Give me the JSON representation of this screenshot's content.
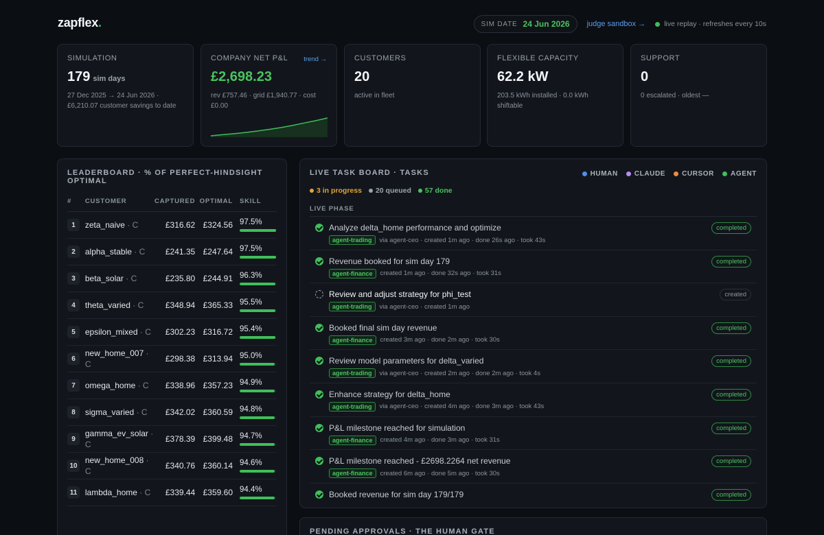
{
  "brand": {
    "name": "zapflex",
    "dot": "."
  },
  "topbar": {
    "sim_date_label": "SIM DATE",
    "sim_date": "24 Jun 2026",
    "judge_link": "judge sandbox →",
    "live_text": "live replay · refreshes every 10s"
  },
  "kpis": {
    "simulation": {
      "label": "SIMULATION",
      "value": "179",
      "unit": "sim days",
      "sub1": "27 Dec 2025 → 24 Jun 2026 ·",
      "sub2": "£6,210.07 customer savings to date"
    },
    "pnl": {
      "label": "COMPANY NET P&L",
      "value": "£2,698.23",
      "trend": "trend →",
      "sub1": "rev £757.46 · grid £1,940.77 · cost",
      "sub2": "£0.00",
      "spark": [
        0.0,
        0.06,
        0.12,
        0.19,
        0.27,
        0.36,
        0.46,
        0.58,
        0.72,
        0.85,
        1.0
      ]
    },
    "customers": {
      "label": "CUSTOMERS",
      "value": "20",
      "sub1": "active in fleet"
    },
    "capacity": {
      "label": "FLEXIBLE CAPACITY",
      "value": "62.2 kW",
      "sub1": "203.5 kWh installed · 0.0 kWh",
      "sub2": "shiftable"
    },
    "support": {
      "label": "SUPPORT",
      "value": "0",
      "sub1": "0 escalated · oldest —"
    }
  },
  "leaderboard": {
    "title": "LEADERBOARD · % OF PERFECT-HINDSIGHT OPTIMAL",
    "columns": [
      "#",
      "CUSTOMER",
      "CAPTURED",
      "OPTIMAL",
      "SKILL"
    ],
    "rows": [
      {
        "rank": "1",
        "name": "zeta_naive",
        "tier": "· C",
        "captured": "£316.62",
        "optimal": "£324.56",
        "skill": "97.5%",
        "pct": 97.5
      },
      {
        "rank": "2",
        "name": "alpha_stable",
        "tier": "· C",
        "captured": "£241.35",
        "optimal": "£247.64",
        "skill": "97.5%",
        "pct": 97.5
      },
      {
        "rank": "3",
        "name": "beta_solar",
        "tier": "· C",
        "captured": "£235.80",
        "optimal": "£244.91",
        "skill": "96.3%",
        "pct": 96.3
      },
      {
        "rank": "4",
        "name": "theta_varied",
        "tier": "· C",
        "captured": "£348.94",
        "optimal": "£365.33",
        "skill": "95.5%",
        "pct": 95.5
      },
      {
        "rank": "5",
        "name": "epsilon_mixed",
        "tier": "· C",
        "captured": "£302.23",
        "optimal": "£316.72",
        "skill": "95.4%",
        "pct": 95.4
      },
      {
        "rank": "6",
        "name": "new_home_007",
        "tier": "· C",
        "captured": "£298.38",
        "optimal": "£313.94",
        "skill": "95.0%",
        "pct": 95.0
      },
      {
        "rank": "7",
        "name": "omega_home",
        "tier": "· C",
        "captured": "£338.96",
        "optimal": "£357.23",
        "skill": "94.9%",
        "pct": 94.9
      },
      {
        "rank": "8",
        "name": "sigma_varied",
        "tier": "· C",
        "captured": "£342.02",
        "optimal": "£360.59",
        "skill": "94.8%",
        "pct": 94.8
      },
      {
        "rank": "9",
        "name": "gamma_ev_solar",
        "tier": "· C",
        "captured": "£378.39",
        "optimal": "£399.48",
        "skill": "94.7%",
        "pct": 94.7
      },
      {
        "rank": "10",
        "name": "new_home_008",
        "tier": "· C",
        "captured": "£340.76",
        "optimal": "£360.14",
        "skill": "94.6%",
        "pct": 94.6
      },
      {
        "rank": "11",
        "name": "lambda_home",
        "tier": "· C",
        "captured": "£339.44",
        "optimal": "£359.60",
        "skill": "94.4%",
        "pct": 94.4
      }
    ]
  },
  "taskboard": {
    "title": "LIVE TASK BOARD · TASKS",
    "legend": [
      {
        "label": "HUMAN",
        "color": "#4f8ff0"
      },
      {
        "label": "CLAUDE",
        "color": "#b48cf0"
      },
      {
        "label": "CURSOR",
        "color": "#f08a3c"
      },
      {
        "label": "AGENT",
        "color": "#3fbf5a"
      }
    ],
    "stats": [
      {
        "label": "3 in progress",
        "color": "#e0a23a"
      },
      {
        "label": "20 queued",
        "color": "#9aa2ac"
      },
      {
        "label": "57 done",
        "color": "#4cc25f"
      }
    ],
    "phase": "LIVE PHASE",
    "tasks": [
      {
        "title": "Analyze delta_home performance and optimize",
        "tag": "agent-trading",
        "meta": "via agent-ceo · created 1m ago · done 26s ago · took 43s",
        "status": "completed",
        "done": true
      },
      {
        "title": "Revenue booked for sim day 179",
        "tag": "agent-finance",
        "meta": "created 1m ago · done 32s ago · took 31s",
        "status": "completed",
        "done": true
      },
      {
        "title": "Review and adjust strategy for phi_test",
        "tag": "agent-trading",
        "meta": "via agent-ceo · created 1m ago",
        "status": "created",
        "done": false
      },
      {
        "title": "Booked final sim day revenue",
        "tag": "agent-finance",
        "meta": "created 3m ago · done 2m ago · took 30s",
        "status": "completed",
        "done": true
      },
      {
        "title": "Review model parameters for delta_varied",
        "tag": "agent-trading",
        "meta": "via agent-ceo · created 2m ago · done 2m ago · took 4s",
        "status": "completed",
        "done": true
      },
      {
        "title": "Enhance strategy for delta_home",
        "tag": "agent-trading",
        "meta": "via agent-ceo · created 4m ago · done 3m ago · took 43s",
        "status": "completed",
        "done": true
      },
      {
        "title": "P&L milestone reached for simulation",
        "tag": "agent-finance",
        "meta": "created 4m ago · done 3m ago · took 31s",
        "status": "completed",
        "done": true
      },
      {
        "title": "P&L milestone reached - £2698.2264 net revenue",
        "tag": "agent-finance",
        "meta": "created 6m ago · done 5m ago · took 30s",
        "status": "completed",
        "done": true
      },
      {
        "title": "Booked revenue for sim day 179/179",
        "tag": "",
        "meta": "",
        "status": "completed",
        "done": true
      }
    ]
  },
  "pending": {
    "title": "PENDING APPROVALS · THE HUMAN GATE"
  }
}
